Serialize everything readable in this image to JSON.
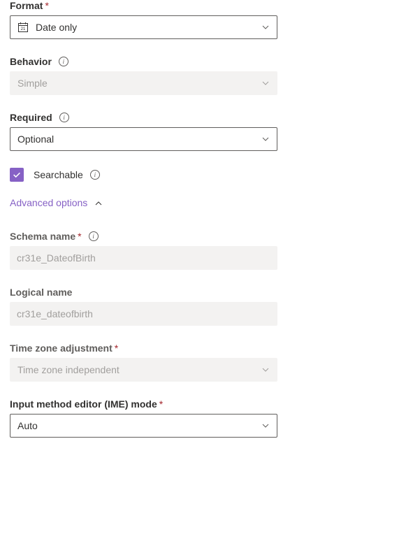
{
  "format": {
    "label": "Format",
    "required": "*",
    "value": "Date only"
  },
  "behavior": {
    "label": "Behavior",
    "value": "Simple"
  },
  "required_field": {
    "label": "Required",
    "value": "Optional"
  },
  "searchable": {
    "label": "Searchable"
  },
  "advanced": {
    "label": "Advanced options"
  },
  "schema_name": {
    "label": "Schema name",
    "required": "*",
    "value": "cr31e_DateofBirth"
  },
  "logical_name": {
    "label": "Logical name",
    "value": "cr31e_dateofbirth"
  },
  "timezone": {
    "label": "Time zone adjustment",
    "required": "*",
    "value": "Time zone independent"
  },
  "ime": {
    "label": "Input method editor (IME) mode",
    "required": "*",
    "value": "Auto"
  }
}
